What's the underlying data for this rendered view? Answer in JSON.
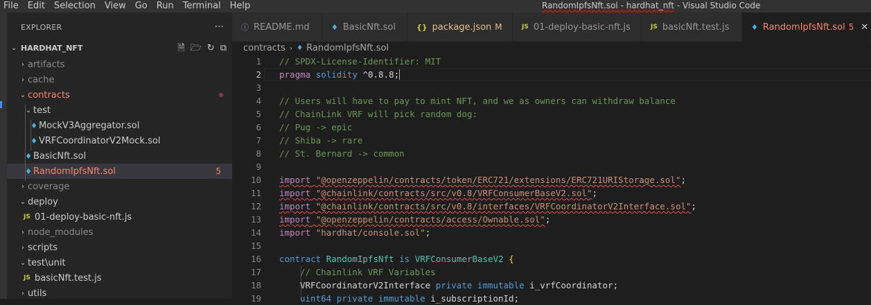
{
  "menu": [
    "File",
    "Edit",
    "Selection",
    "View",
    "Go",
    "Run",
    "Terminal",
    "Help"
  ],
  "window_title": {
    "file": "RandomIpfsNft.sol",
    "sep1": " - ",
    "project": "hardhat_nft",
    "sep2": " - ",
    "app": "Visual Studio Code"
  },
  "explorer": {
    "title": "EXPLORER",
    "more": "···",
    "project": "HARDHAT_NFT",
    "items": [
      {
        "label": "artifacts"
      },
      {
        "label": "cache"
      },
      {
        "label": "contracts"
      },
      {
        "label": "test"
      },
      {
        "label": "MockV3Aggregator.sol"
      },
      {
        "label": "VRFCoordinatorV2Mock.sol"
      },
      {
        "label": "BasicNft.sol"
      },
      {
        "label": "RandomIpfsNft.sol",
        "badge": "5"
      },
      {
        "label": "coverage"
      },
      {
        "label": "deploy"
      },
      {
        "label": "01-deploy-basic-nft.js"
      },
      {
        "label": "node_modules"
      },
      {
        "label": "scripts"
      },
      {
        "label": "test\\unit"
      },
      {
        "label": "basicNft.test.js"
      },
      {
        "label": "utils"
      }
    ]
  },
  "tabs": [
    {
      "label": "README.md",
      "icon": "info-icon"
    },
    {
      "label": "BasicNft.sol",
      "icon": "ethereum-icon"
    },
    {
      "label": "package.json",
      "icon": "json-icon",
      "suffix": "M"
    },
    {
      "label": "01-deploy-basic-nft.js",
      "icon": "js-icon"
    },
    {
      "label": "basicNft.test.js",
      "icon": "js-icon"
    },
    {
      "label": "RandomIpfsNft.sol",
      "icon": "ethereum-icon",
      "suffix": "5",
      "active": true
    }
  ],
  "breadcrumb": [
    "contracts",
    "RandomIpfsNft.sol"
  ],
  "code": {
    "line_numbers": [
      "1",
      "2",
      "3",
      "4",
      "5",
      "6",
      "7",
      "8",
      "9",
      "10",
      "11",
      "12",
      "13",
      "14",
      "15",
      "16",
      "17",
      "18",
      "19"
    ],
    "l1": "// SPDX-License-Identifier: MIT",
    "l2_kw": "pragma",
    "l2_sol": "solidity",
    "l2_ver": "^0.8.8;",
    "l4": "// Users will have to pay to mint NFT, and we as owners can withdraw balance",
    "l5": "// ChainLink VRF will pick random dog:",
    "l6": "// Pug -> epic",
    "l7": "// Shiba -> rare",
    "l8": "// St. Bernard -> common",
    "import_kw": "import",
    "l10": "\"@openzeppelin/contracts/token/ERC721/extensions/ERC721URIStorage.sol\"",
    "l11": "\"@chainlink/contracts/src/v0.8/VRFConsumerBaseV2.sol\"",
    "l12": "\"@chainlink/contracts/src/v0.8/interfaces/VRFCoordinatorV2Interface.sol\"",
    "l13": "\"@openzeppelin/contracts/access/Ownable.sol\"",
    "l14": "\"hardhat/console.sol\"",
    "semi": ";",
    "l16_kw": "contract",
    "l16_name": "RandomIpfsNft",
    "l16_is": "is",
    "l16_base": "VRFConsumerBaseV2",
    "l16_brace": "{",
    "l17": "// Chainlink VRF Variables",
    "l18_type": "VRFCoordinatorV2Interface",
    "l18_priv": "private",
    "l18_imm": "immutable",
    "l18_var": "i_vrfCoordinator;",
    "l19_type": "uint64",
    "l19_priv": "private",
    "l19_imm": "immutable",
    "l19_var": "i_subscriptionId;"
  },
  "colors": {
    "accent_error": "#f48771",
    "comment": "#6a9955",
    "keyword": "#569cd6",
    "string": "#ce9178"
  }
}
